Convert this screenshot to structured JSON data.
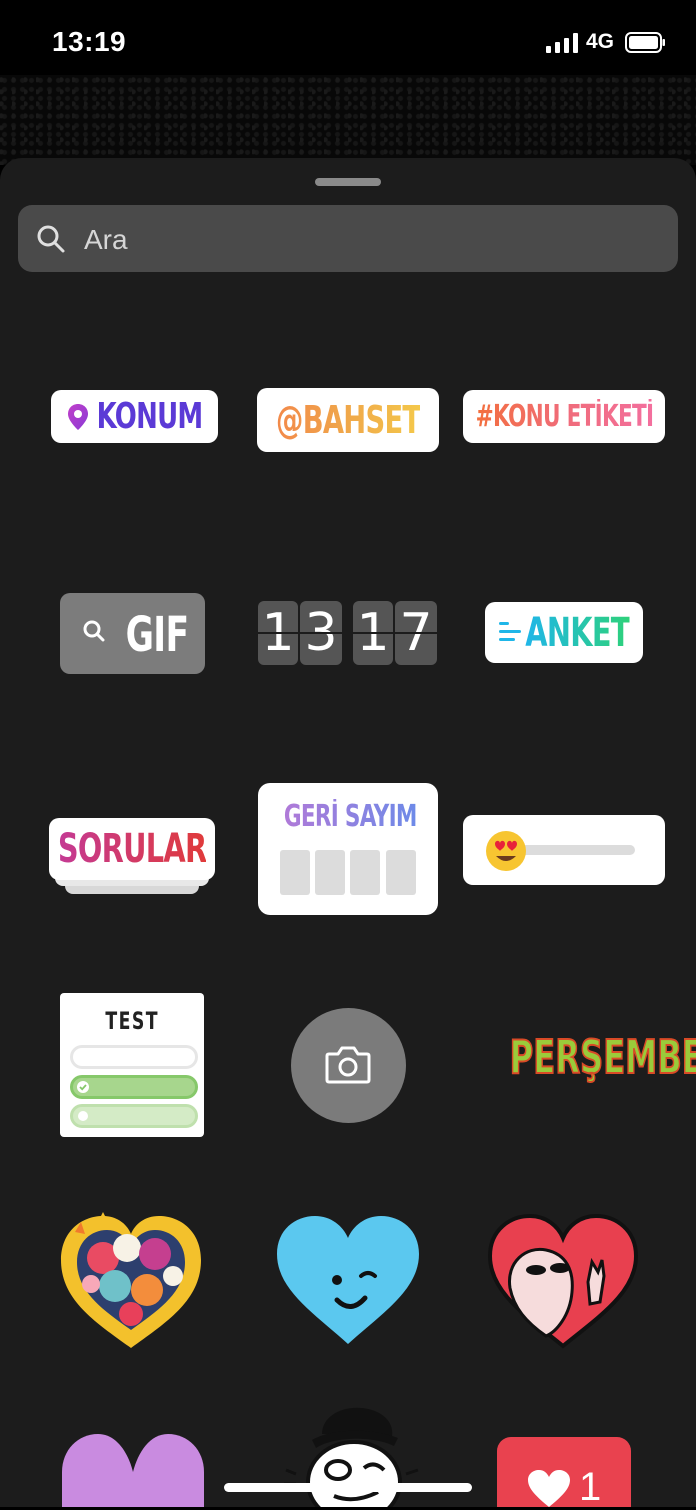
{
  "status_bar": {
    "time": "13:19",
    "network": "4G"
  },
  "search": {
    "placeholder": "Ara"
  },
  "stickers": {
    "location": "KONUM",
    "mention": "@BAHSET",
    "hashtag": "#KONU ETİKETİ",
    "gif": "GIF",
    "time_hours": [
      "1",
      "3"
    ],
    "time_minutes": [
      "1",
      "7"
    ],
    "poll": "ANKET",
    "questions": "SORULAR",
    "countdown": "GERİ SAYIM",
    "quiz": "TEST",
    "day": "PERŞEMBE",
    "like_count": "1"
  },
  "colors": {
    "background": "#000000",
    "sheet": "#1c1c1c",
    "search_field": "#4a4a4a",
    "heart_blue": "#5bc8ef",
    "heart_red": "#e8404f",
    "heart_purple": "#c98be0",
    "like_badge": "#e9424f"
  }
}
